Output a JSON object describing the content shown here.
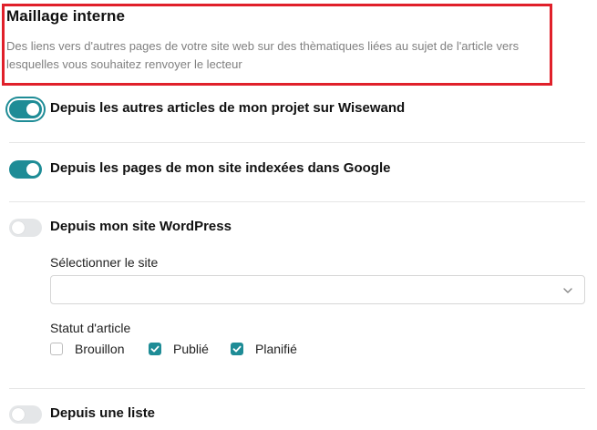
{
  "section": {
    "title": "Maillage interne",
    "description": "Des liens vers d'autres pages de votre site web sur des thèmatiques liées au sujet de l'article vers lesquelles vous souhaitez renvoyer le lecteur"
  },
  "options": [
    {
      "label": "Depuis les autres articles de mon projet sur Wisewand",
      "enabled": true
    },
    {
      "label": "Depuis les pages de mon site indexées dans Google",
      "enabled": true
    },
    {
      "label": "Depuis mon site WordPress",
      "enabled": false
    },
    {
      "label": "Depuis une liste",
      "enabled": false
    }
  ],
  "wordpress": {
    "site_label": "Sélectionner le site",
    "site_value": "",
    "status_label": "Statut d'article",
    "statuses": [
      {
        "label": "Brouillon",
        "checked": false
      },
      {
        "label": "Publié",
        "checked": true
      },
      {
        "label": "Planifié",
        "checked": true
      }
    ]
  },
  "colors": {
    "accent": "#1e8c96",
    "highlight_border": "#e0202a",
    "muted_text": "#808080"
  },
  "icons": {
    "select_arrow": "chevron-down-icon",
    "checked": "check-icon"
  }
}
